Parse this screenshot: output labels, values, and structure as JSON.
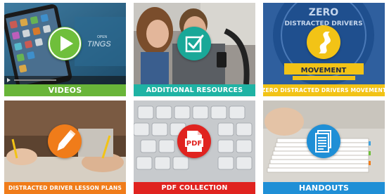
{
  "tiles": [
    {
      "id": "videos",
      "label": "VIDEOS",
      "icon": "play-icon",
      "label_color": "#69b539",
      "badge_color": "#6fbf3b"
    },
    {
      "id": "additional-resources",
      "label": "ADDITIONAL RESOURCES",
      "icon": "checkbox-icon",
      "label_color": "#1fb3a4",
      "badge_color": "#1aa898"
    },
    {
      "id": "zero-distracted-drivers-movement",
      "label": "ZERO DISTRACTED DRIVERS MOVEMENT",
      "icon": "road-icon",
      "label_color": "#f2c316",
      "badge_color": "#f2c316"
    },
    {
      "id": "lesson-plans",
      "label": "DISTRACTED DRIVER LESSON PLANS",
      "icon": "pencil-icon",
      "label_color": "#f07c1a",
      "badge_color": "#f07c1a"
    },
    {
      "id": "pdf-collection",
      "label": "PDF COLLECTION",
      "icon": "pdf-icon",
      "label_color": "#e0231f",
      "badge_color": "#e0231f"
    },
    {
      "id": "handouts",
      "label": "HANDOUTS",
      "icon": "document-icon",
      "label_color": "#1f8fd6",
      "badge_color": "#1f8fd6"
    }
  ],
  "art_text": {
    "phone_screen": "TINGS",
    "phone_open": "OPEN",
    "sign_line1": "ZERO",
    "sign_line2": "DISTRACTED DRIVERS",
    "sign_line3": "MOVEMENT",
    "pdf_text": "PDF"
  }
}
